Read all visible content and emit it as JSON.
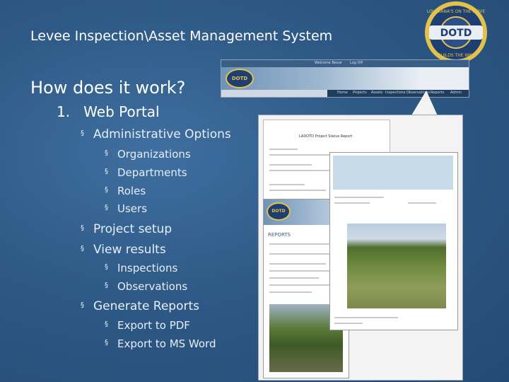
{
  "slide": {
    "title": "Levee Inspection\\Asset Management System",
    "heading": "How does it work?",
    "level1": {
      "number": "1.",
      "label": "Web Portal"
    },
    "bullet_glyph": "§",
    "items": [
      {
        "label": "Administrative Options",
        "children": [
          "Organizations",
          "Departments",
          "Roles",
          "Users"
        ]
      },
      {
        "label": "Project setup",
        "children": []
      },
      {
        "label": "View results",
        "children": [
          "Inspections",
          "Observations"
        ]
      },
      {
        "label": "Generate Reports",
        "children": [
          "Export to PDF",
          "Export to MS Word"
        ]
      }
    ],
    "logo": {
      "top_text": "LOUISIANA'S ON THE MOVE",
      "center_text": "DOTD",
      "bottom_text": "BUILDS THE WAY",
      "colors": {
        "ring": "#e2c24a",
        "inner": "#1f3f73"
      }
    },
    "screenshot_top": {
      "bar_left": "Welcome Bexar",
      "bar_right": "Log Off",
      "logo_text": "DOTD",
      "nav": [
        "Home",
        "Projects",
        "Assets",
        "Inspections",
        "Observations",
        "Reports",
        "Admin"
      ]
    },
    "screenshot_docs": {
      "report_title": "LADOTD Project Status Report",
      "reports_label": "REPORTS",
      "doc3_logo": "DOTD"
    }
  }
}
